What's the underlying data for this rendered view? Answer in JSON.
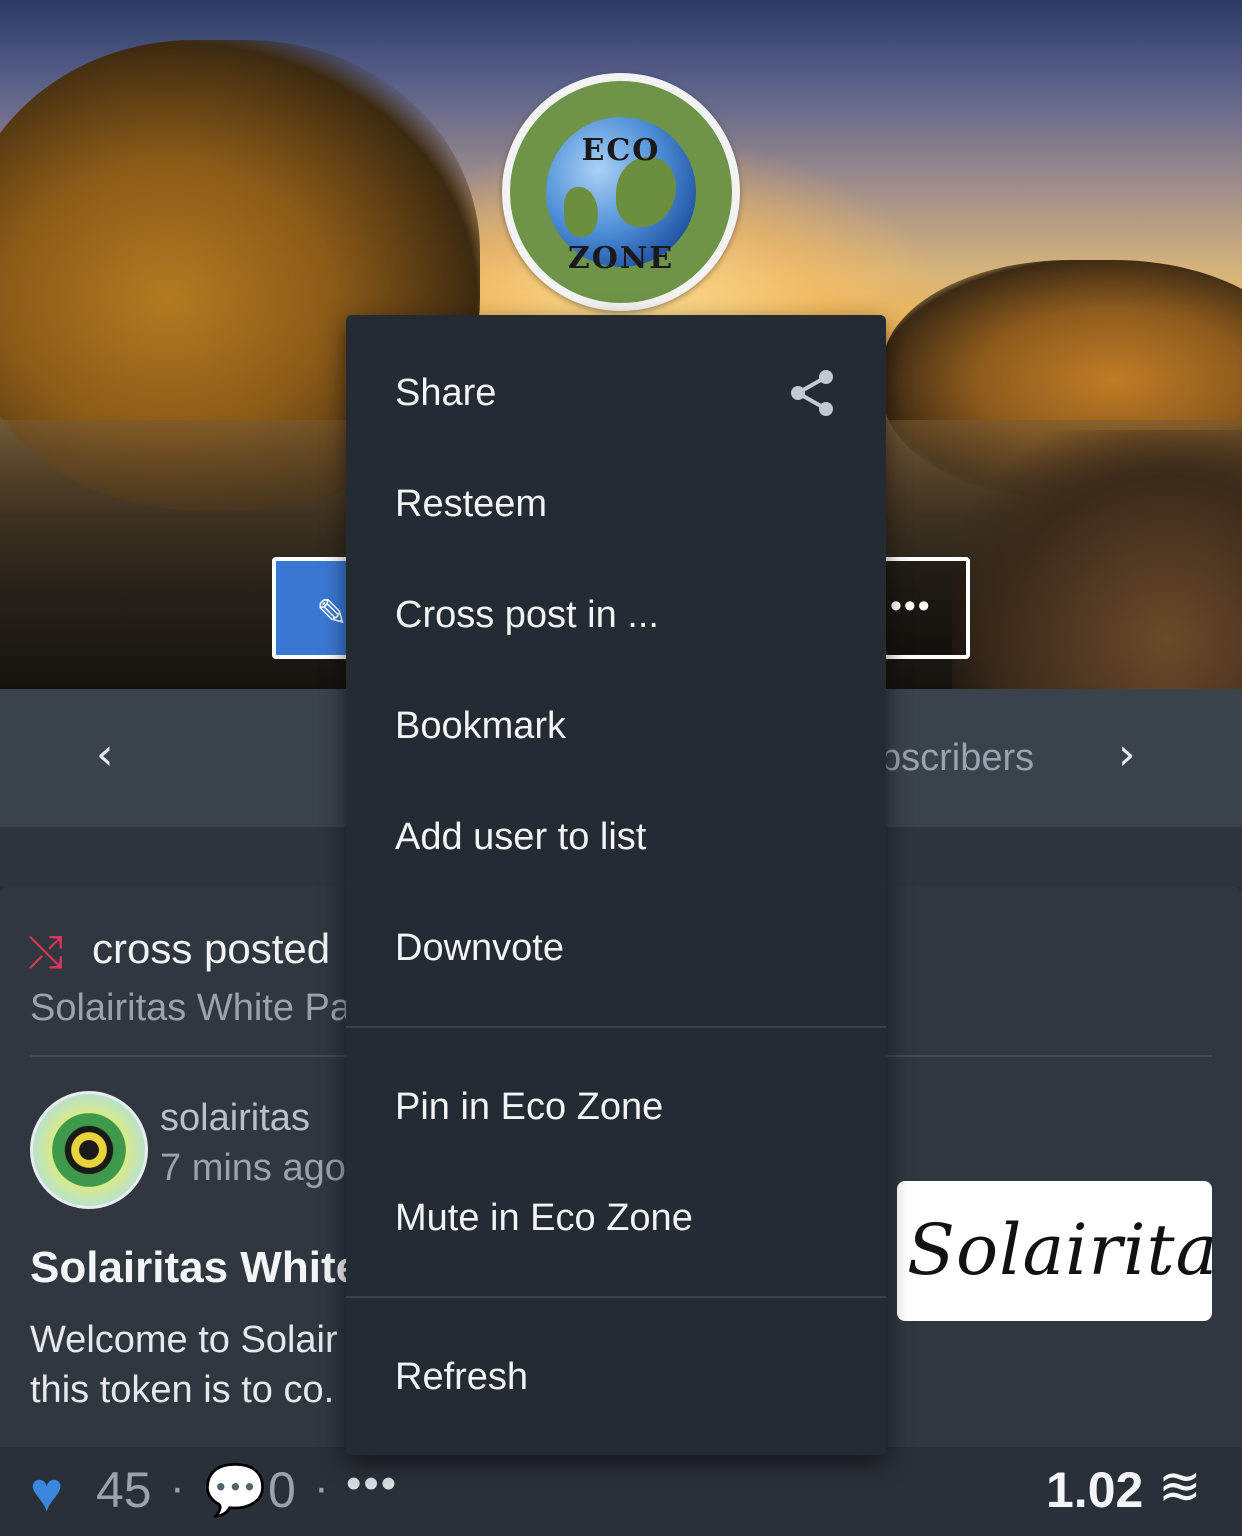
{
  "cover": {
    "logo_top_text": "ECO",
    "logo_bottom_text": "ZONE",
    "more_dots": "•••"
  },
  "info_strip": {
    "subscribers_label": "bscribers"
  },
  "post": {
    "cross_posted_label": "cross posted",
    "cross_post_title": "Solairitas White Pa",
    "author": "solairitas",
    "time_ago": "7 mins ago",
    "title": "Solairitas White",
    "excerpt": "Welcome to Solair\nthis token is to co.",
    "thumbnail_text": "Solairitas"
  },
  "footer": {
    "votes": "45",
    "comments": "0",
    "separator": "·",
    "more": "•••",
    "payout": "1.02"
  },
  "menu": {
    "items": [
      {
        "label": "Share"
      },
      {
        "label": "Resteem"
      },
      {
        "label": "Cross post in ..."
      },
      {
        "label": "Bookmark"
      },
      {
        "label": "Add user to list"
      },
      {
        "label": "Downvote"
      },
      {
        "label": "Pin in Eco Zone"
      },
      {
        "label": "Mute in Eco Zone"
      },
      {
        "label": "Refresh"
      }
    ]
  },
  "icons": {
    "share": "share-icon",
    "cross_post": "shuffle-icon",
    "heart": "heart-icon",
    "comment": "comment-icon",
    "steem": "steem-icon",
    "edit": "pencil-icon"
  },
  "colors": {
    "accent_blue": "#3a78d4",
    "cross_post_red": "#e0345a",
    "heart_blue": "#3b87e0",
    "menu_bg": "#252b32",
    "card_bg": "#30373f"
  }
}
